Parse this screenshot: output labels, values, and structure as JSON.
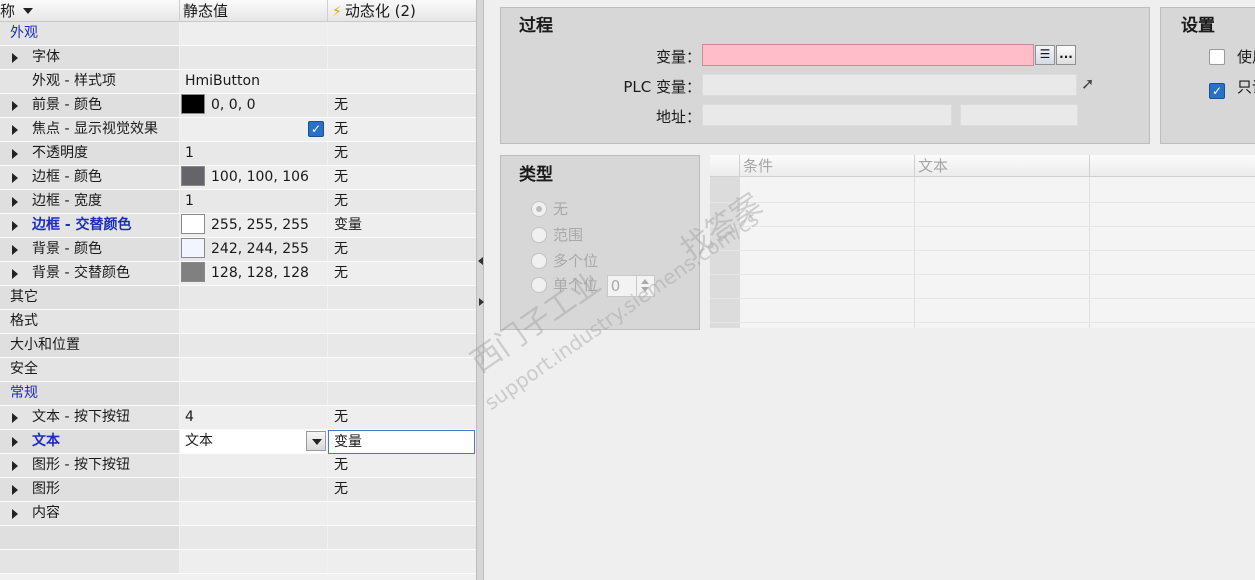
{
  "grid": {
    "header": {
      "col_name": "称",
      "col_static": "静态值",
      "col_dynamic": "动态化 (2)",
      "bolt_icon": "lightning-icon"
    },
    "rows": [
      {
        "kind": "cat",
        "name": "外观",
        "blue": true
      },
      {
        "kind": "prop",
        "name": "字体",
        "static": "",
        "dynamic": ""
      },
      {
        "kind": "sub",
        "name": "外观 - 样式项",
        "static": "HmiButton",
        "dynamic": ""
      },
      {
        "kind": "prop",
        "name": "前景 - 颜色",
        "static": "0, 0, 0",
        "dynamic": "无",
        "swatch": "#000000"
      },
      {
        "kind": "prop",
        "name": "焦点 - 显示视觉效果",
        "static": "",
        "dynamic": "无",
        "checkbox": true
      },
      {
        "kind": "prop",
        "name": "不透明度",
        "static": "1",
        "dynamic": "无"
      },
      {
        "kind": "prop",
        "name": "边框 - 颜色",
        "static": "100, 100, 106",
        "dynamic": "无",
        "swatch": "#64646a"
      },
      {
        "kind": "prop",
        "name": "边框 - 宽度",
        "static": "1",
        "dynamic": "无"
      },
      {
        "kind": "prop",
        "name": "边框 - 交替颜色",
        "static": "255, 255, 255",
        "dynamic": "变量",
        "swatch": "#ffffff",
        "bold": true
      },
      {
        "kind": "prop",
        "name": "背景 - 颜色",
        "static": "242, 244, 255",
        "dynamic": "无",
        "swatch": "#f2f4ff"
      },
      {
        "kind": "prop",
        "name": "背景 - 交替颜色",
        "static": "128, 128, 128",
        "dynamic": "无",
        "swatch": "#808080"
      },
      {
        "kind": "cat",
        "name": "其它"
      },
      {
        "kind": "cat",
        "name": "格式"
      },
      {
        "kind": "cat",
        "name": "大小和位置"
      },
      {
        "kind": "cat",
        "name": "安全"
      },
      {
        "kind": "cat",
        "name": "常规",
        "blue": true
      },
      {
        "kind": "prop",
        "name": "文本 - 按下按钮",
        "static": "4",
        "dynamic": "无"
      },
      {
        "kind": "prop",
        "name": "文本",
        "static": "文本",
        "dynamic": "变量",
        "bold": true,
        "combo": true,
        "editing": true
      },
      {
        "kind": "prop",
        "name": "图形 - 按下按钮",
        "static": "",
        "dynamic": "无"
      },
      {
        "kind": "prop",
        "name": "图形",
        "static": "",
        "dynamic": "无"
      },
      {
        "kind": "prop",
        "name": "内容",
        "static": "",
        "dynamic": ""
      },
      {
        "kind": "empty",
        "name": ""
      },
      {
        "kind": "empty",
        "name": ""
      }
    ]
  },
  "process": {
    "title": "过程",
    "variable_label": "变量：",
    "plc_variable_label": "PLC 变量：",
    "address_label": "地址：",
    "variable_value": "",
    "browse_button": "...",
    "list_icon": "list-icon",
    "goto_icon": "arrow-up-right-icon"
  },
  "settings": {
    "title": "设置",
    "option1": "使用",
    "option1_checked": false,
    "option2": "只读",
    "option2_checked": true
  },
  "type": {
    "title": "类型",
    "options": [
      "无",
      "范围",
      "多个位",
      "单个位"
    ],
    "selected": "无",
    "bit_value": "0"
  },
  "condition_table": {
    "col_condition": "条件",
    "col_text": "文本"
  },
  "watermark": {
    "line1": "西门子工业",
    "line2": "找答案",
    "line3": "support.industry.siemens.com/cs"
  }
}
